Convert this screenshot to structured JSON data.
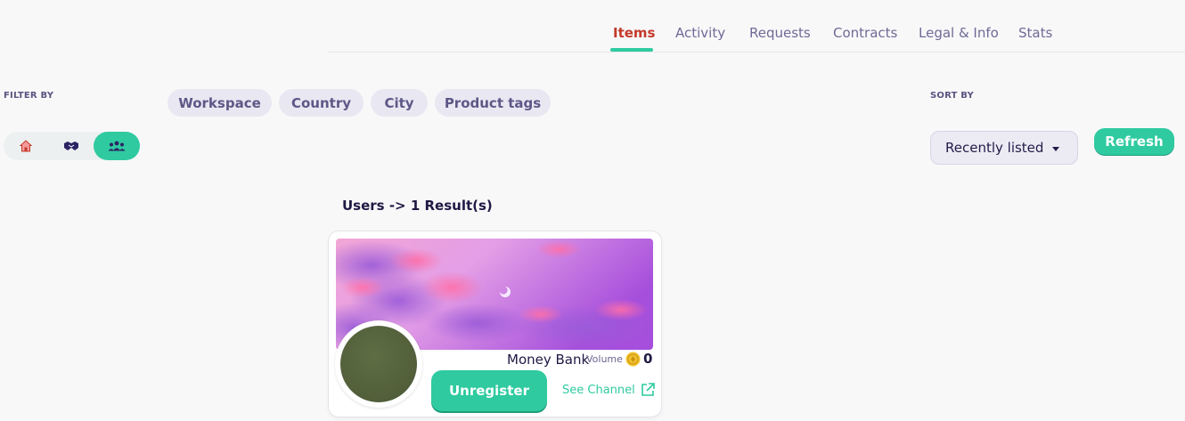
{
  "tabs": [
    {
      "label": "Items",
      "active": true
    },
    {
      "label": "Activity"
    },
    {
      "label": "Requests"
    },
    {
      "label": "Contracts"
    },
    {
      "label": "Legal & Info"
    },
    {
      "label": "Stats"
    }
  ],
  "filter": {
    "label": "FILTER BY",
    "icons": [
      "house-icon",
      "handshake-icon",
      "users-icon"
    ],
    "active_icon": "users-icon",
    "chips": [
      "Workspace",
      "Country",
      "City",
      "Product tags"
    ]
  },
  "sort": {
    "label": "SORT BY",
    "selected": "Recently listed",
    "refresh_label": "Refresh"
  },
  "results": {
    "title": "Users -> 1 Result(s)"
  },
  "card": {
    "name": "Money Bank",
    "volume_label": "Volume",
    "volume_value": "0",
    "unregister_label": "Unregister",
    "see_channel_label": "See Channel"
  },
  "colors": {
    "accent": "#2fcaa0",
    "active_tab": "#c43a2a",
    "chip_bg": "#e9e7f2"
  }
}
